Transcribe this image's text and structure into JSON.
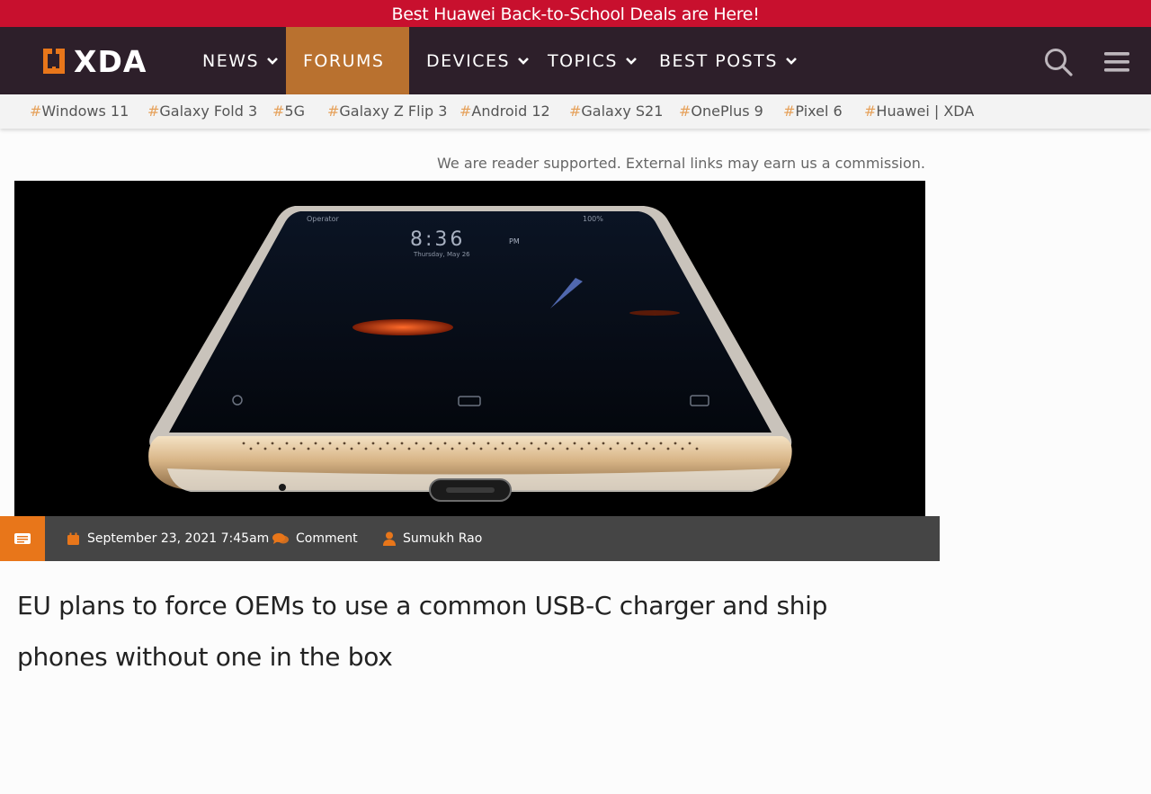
{
  "promo": {
    "text": "Best Huawei Back-to-School Deals are Here!"
  },
  "header": {
    "logo_text": "XDA",
    "nav": [
      {
        "label": "NEWS",
        "active": false
      },
      {
        "label": "FORUMS",
        "active": true
      },
      {
        "label": "DEVICES",
        "active": false
      },
      {
        "label": "TOPICS",
        "active": false
      },
      {
        "label": "BEST POSTS",
        "active": false
      }
    ],
    "icons": {
      "search": "search-icon",
      "menu": "hamburger-menu-icon"
    }
  },
  "tags": [
    {
      "hash": "#",
      "label": "Windows 11"
    },
    {
      "hash": "#",
      "label": "Galaxy Fold 3"
    },
    {
      "hash": "#",
      "label": "5G"
    },
    {
      "hash": "#",
      "label": "Galaxy Z Flip 3"
    },
    {
      "hash": "#",
      "label": "Android 12"
    },
    {
      "hash": "#",
      "label": "Galaxy S21"
    },
    {
      "hash": "#",
      "label": "OnePlus 9"
    },
    {
      "hash": "#",
      "label": "Pixel 6"
    },
    {
      "hash": "#",
      "label": "Huawei | XDA"
    }
  ],
  "disclosure": "We are reader supported. External links may earn us a commission.",
  "hero_phone": {
    "status_left": "Operator",
    "status_right": "100%",
    "clock": "8:36",
    "clock_suffix": "PM",
    "date": "Thursday, May 26"
  },
  "meta": {
    "date": "September 23, 2021 7:45am",
    "comment": "Comment",
    "author": "Sumukh Rao"
  },
  "article": {
    "title": "EU plans to force OEMs to use a common USB-C charger and ship phones without one in the box"
  },
  "colors": {
    "promo_bg": "#c8102e",
    "nav_bg": "#2d1f2a",
    "nav_active": "#b9712f",
    "accent_orange": "#e8761a",
    "meta_bg": "#454545"
  }
}
